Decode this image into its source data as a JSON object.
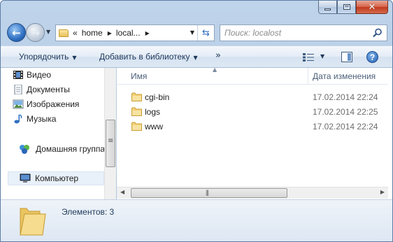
{
  "window": {
    "caption_buttons": {
      "minimize": "minimize",
      "maximize": "maximize",
      "close": "✕"
    }
  },
  "address_bar": {
    "overflow": "«",
    "crumbs": [
      "home",
      "local..."
    ]
  },
  "search": {
    "placeholder": "Поиск: localost"
  },
  "toolbar": {
    "organize_label": "Упорядочить",
    "add_to_library_label": "Добавить в библиотеку",
    "more_label": "»"
  },
  "nav_pane": {
    "items": [
      {
        "label": "Видео",
        "icon": "video-icon"
      },
      {
        "label": "Документы",
        "icon": "documents-icon"
      },
      {
        "label": "Изображения",
        "icon": "pictures-icon"
      },
      {
        "label": "Музыка",
        "icon": "music-icon"
      }
    ],
    "homegroup_label": "Домашняя группа",
    "computer_label": "Компьютер"
  },
  "content": {
    "columns": {
      "name": "Имя",
      "date": "Дата изменения"
    },
    "files": [
      {
        "name": "cgi-bin",
        "date": "17.02.2014 22:24"
      },
      {
        "name": "logs",
        "date": "17.02.2014 22:25"
      },
      {
        "name": "www",
        "date": "17.02.2014 22:24"
      }
    ]
  },
  "details": {
    "count_label": "Элементов: 3"
  },
  "colors": {
    "chrome": "#b3cbe4",
    "accent": "#2f6fc1",
    "folder": "#e8c25a",
    "link_text": "#1e395b"
  }
}
